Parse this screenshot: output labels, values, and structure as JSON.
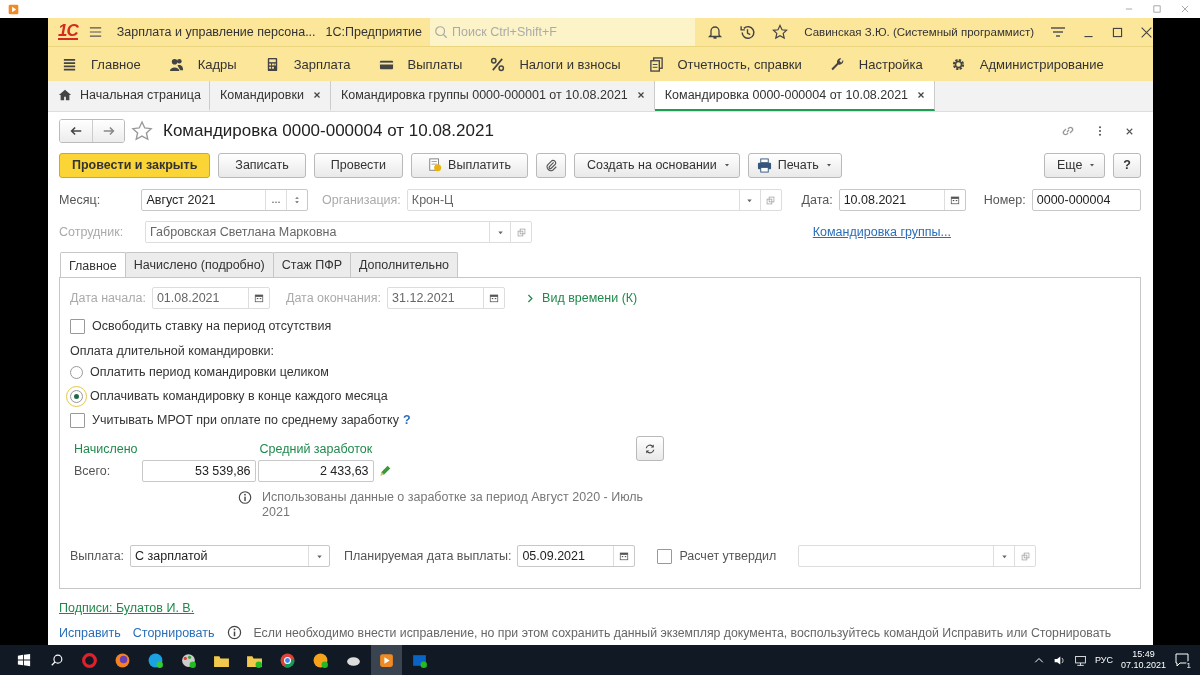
{
  "logo": "1С",
  "header": {
    "app_name": "Зарплата и управление персона...",
    "platform": "1С:Предприятие",
    "search_placeholder": "Поиск Ctrl+Shift+F",
    "user": "Савинская З.Ю. (Системный программист)"
  },
  "sections": [
    {
      "label": "Главное"
    },
    {
      "label": "Кадры"
    },
    {
      "label": "Зарплата"
    },
    {
      "label": "Выплаты"
    },
    {
      "label": "Налоги и взносы"
    },
    {
      "label": "Отчетность, справки"
    },
    {
      "label": "Настройка"
    },
    {
      "label": "Администрирование"
    }
  ],
  "open_tabs": [
    {
      "label": "Начальная страница",
      "closable": false,
      "selected": false
    },
    {
      "label": "Командировки",
      "closable": true,
      "selected": false
    },
    {
      "label": "Командировка группы 0000-000001 от 10.08.2021",
      "closable": true,
      "selected": false
    },
    {
      "label": "Командировка 0000-000004 от 10.08.2021",
      "closable": true,
      "selected": true
    }
  ],
  "document": {
    "title": "Командировка 0000-000004 от 10.08.2021"
  },
  "commands": [
    {
      "label": "Провести и закрыть",
      "kind": "primary"
    },
    {
      "label": "Записать",
      "kind": "plain"
    },
    {
      "label": "Провести",
      "kind": "plain"
    },
    {
      "label": "Выплатить",
      "kind": "pay"
    },
    {
      "kind": "attach"
    },
    {
      "label": "Создать на основании",
      "kind": "menu"
    },
    {
      "label": "Печать",
      "kind": "print"
    }
  ],
  "right_commands": [
    {
      "label": "Еще",
      "kind": "menu"
    },
    {
      "label": "?",
      "kind": "plain"
    }
  ],
  "month": {
    "label": "Месяц:",
    "value": "Август 2021",
    "disabled": false
  },
  "organization": {
    "label": "Организация:",
    "value": "Крон-Ц",
    "disabled": true
  },
  "date": {
    "label": "Дата:",
    "value": "10.08.2021",
    "disabled": false
  },
  "number": {
    "label": "Номер:",
    "value": "0000-000004",
    "disabled": false
  },
  "employee": {
    "label": "Сотрудник:",
    "value": "Габровская Светлана Марковна",
    "disabled": true
  },
  "group_link": "Командировка группы...",
  "form_tabs": [
    {
      "label": "Главное",
      "selected": true
    },
    {
      "label": "Начислено (подробно)",
      "selected": false
    },
    {
      "label": "Стаж ПФР",
      "selected": false
    },
    {
      "label": "Дополнительно",
      "selected": false
    }
  ],
  "start_date": {
    "label": "Дата начала:",
    "value": "01.08.2021",
    "disabled": true
  },
  "end_date": {
    "label": "Дата окончания:",
    "value": "31.12.2021",
    "disabled": true
  },
  "time_type_link": "Вид времени (К)",
  "release_rate": {
    "label": "Освободить ставку на период отсутствия",
    "checked": false
  },
  "long_trip_payment": {
    "label": "Оплата длительной командировки:",
    "options": [
      {
        "label": "Оплатить период командировки целиком",
        "selected": false
      },
      {
        "label": "Оплачивать командировку в конце каждого месяца",
        "selected": true
      }
    ]
  },
  "mrot": {
    "label": "Учитывать МРОТ при оплате по среднему заработку",
    "checked": false,
    "help": "?"
  },
  "accrued": {
    "heading": "Начислено",
    "label": "Всего:",
    "value": "53 539,86"
  },
  "average": {
    "heading": "Средний заработок",
    "value": "2 433,63"
  },
  "info": "Использованы данные о заработке за период Август 2020 - Июль 2021",
  "payment": {
    "label": "Выплата:",
    "value": "С зарплатой"
  },
  "planned_date": {
    "label": "Планируемая дата выплаты:",
    "value": "05.09.2021"
  },
  "approved": {
    "label": "Расчет утвердил",
    "checked": false
  },
  "signatures_link": "Подписи: Булатов И. В.",
  "footer": {
    "links": [
      "Исправить",
      "Сторнировать"
    ],
    "note": "Если необходимо внести исправление, но при этом сохранить данный экземпляр документа, воспользуйтесь командой Исправить или Сторнировать"
  },
  "taskbar": {
    "lang": "РУС",
    "time": "15:49",
    "date": "07.10.2021",
    "notifications": "1"
  }
}
